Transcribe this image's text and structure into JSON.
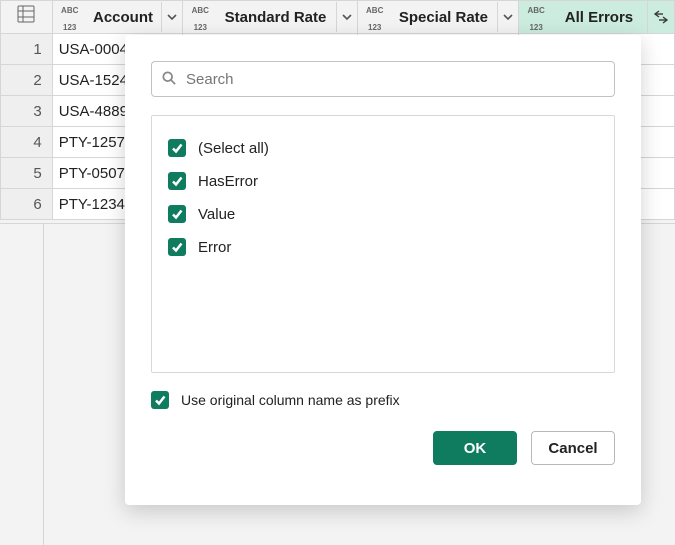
{
  "columns": {
    "account": {
      "label": "Account"
    },
    "standard": {
      "label": "Standard Rate"
    },
    "special": {
      "label": "Special Rate"
    },
    "errors": {
      "label": "All Errors"
    }
  },
  "rows": [
    {
      "n": "1",
      "account": "USA-0004"
    },
    {
      "n": "2",
      "account": "USA-1524"
    },
    {
      "n": "3",
      "account": "USA-4889"
    },
    {
      "n": "4",
      "account": "PTY-1257"
    },
    {
      "n": "5",
      "account": "PTY-0507"
    },
    {
      "n": "6",
      "account": "PTY-1234"
    }
  ],
  "popup": {
    "search_placeholder": "Search",
    "options": {
      "selectAll": "(Select all)",
      "hasError": "HasError",
      "value": "Value",
      "error": "Error"
    },
    "prefix_label": "Use original column name as prefix",
    "ok_label": "OK",
    "cancel_label": "Cancel"
  }
}
